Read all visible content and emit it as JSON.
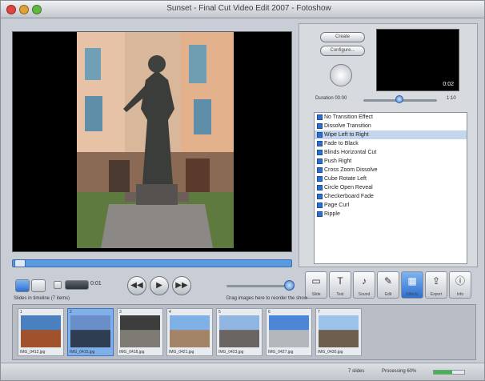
{
  "window": {
    "title": "Sunset - Final Cut Video Edit 2007 - Fotoshow"
  },
  "colors": {
    "accent": "#2e6fd0",
    "selection": "#c4d6ee",
    "progress": "#3fb84a"
  },
  "right_panel": {
    "btn_top": "Create",
    "btn_second": "Configure...",
    "preview_caption": "0:02",
    "duration_label": "Duration 00:00",
    "duration_value": "1:10",
    "effects": [
      "No Transition Effect",
      "Dissolve Transition",
      "Wipe Left to Right",
      "Fade to Black",
      "Blinds Horizontal Cut",
      "Push Right",
      "Cross Zoom Dissolve",
      "Cube Rotate Left",
      "Circle Open Reveal",
      "Checkerboard Fade",
      "Page Curl",
      "Ripple"
    ],
    "selected_effect_index": 2
  },
  "strip": {
    "header_left": "Slides in timeline (7 items)",
    "header_center": "Drag images here to reorder the show",
    "clips": [
      {
        "num": "1",
        "caption": "IMG_0412.jpg"
      },
      {
        "num": "2",
        "caption": "IMG_0415.jpg"
      },
      {
        "num": "3",
        "caption": "IMG_0418.jpg"
      },
      {
        "num": "4",
        "caption": "IMG_0421.jpg"
      },
      {
        "num": "5",
        "caption": "IMG_0423.jpg"
      },
      {
        "num": "6",
        "caption": "IMG_0427.jpg"
      },
      {
        "num": "7",
        "caption": "IMG_0430.jpg"
      }
    ]
  },
  "transport": {
    "time": "0:01",
    "play_icon": "play-icon",
    "rewind_icon": "rewind-icon",
    "forward_icon": "forward-icon"
  },
  "tools": [
    {
      "label": "Slide",
      "icon": "slide-icon"
    },
    {
      "label": "Text",
      "icon": "text-icon"
    },
    {
      "label": "Sound",
      "icon": "sound-icon"
    },
    {
      "label": "Edit",
      "icon": "edit-icon"
    },
    {
      "label": "Effects",
      "icon": "effects-icon"
    },
    {
      "label": "Export",
      "icon": "export-icon"
    },
    {
      "label": "Info",
      "icon": "info-icon"
    }
  ],
  "status": {
    "left": "7 slides",
    "right": "Processing 60%",
    "progress": 0.6
  }
}
